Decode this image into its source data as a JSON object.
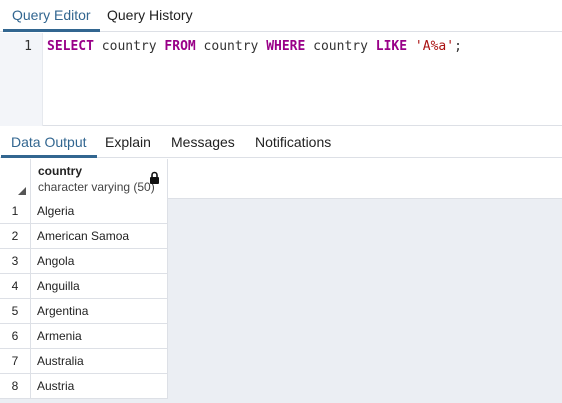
{
  "top_tabs": {
    "query_editor": "Query Editor",
    "query_history": "Query History"
  },
  "editor": {
    "line_number": "1",
    "tokens": {
      "select": "SELECT",
      "col": " country ",
      "from": "FROM",
      "table": " country ",
      "where": "WHERE",
      "col2": " country ",
      "like": "LIKE",
      "space": " ",
      "pattern": "'A%a'",
      "semicolon": ";"
    }
  },
  "bottom_tabs": {
    "data_output": "Data Output",
    "explain": "Explain",
    "messages": "Messages",
    "notifications": "Notifications"
  },
  "grid": {
    "column": {
      "name": "country",
      "type": "character varying (50)",
      "icon": "lock-icon"
    },
    "rows": [
      {
        "num": "1",
        "value": "Algeria"
      },
      {
        "num": "2",
        "value": "American Samoa"
      },
      {
        "num": "3",
        "value": "Angola"
      },
      {
        "num": "4",
        "value": "Anguilla"
      },
      {
        "num": "5",
        "value": "Argentina"
      },
      {
        "num": "6",
        "value": "Armenia"
      },
      {
        "num": "7",
        "value": "Australia"
      },
      {
        "num": "8",
        "value": "Austria"
      }
    ]
  },
  "colors": {
    "accent": "#326690",
    "keyword": "#990088",
    "string": "#aa1111",
    "grid_bg": "#ebeef3"
  }
}
